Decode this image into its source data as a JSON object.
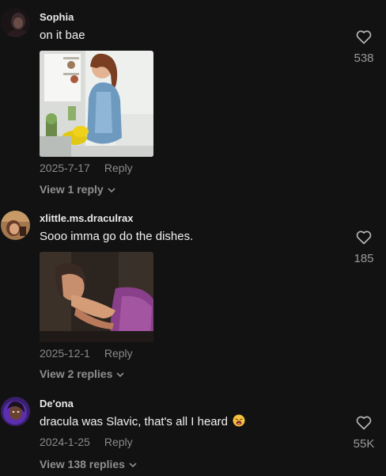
{
  "comments": [
    {
      "username": "Sophia",
      "text": "on it bae",
      "date": "2025-7-17",
      "reply_label": "Reply",
      "view_replies": "View 1 reply",
      "likes": "538"
    },
    {
      "username": "xlittle.ms.draculrax",
      "text": "Sooo imma go do the dishes.",
      "date": "2025-12-1",
      "reply_label": "Reply",
      "view_replies": "View 2 replies",
      "likes": "185"
    },
    {
      "username": "De'ona",
      "text": "dracula was Slavic, that's all I heard",
      "date": "2024-1-25",
      "reply_label": "Reply",
      "view_replies": "View 138 replies",
      "likes": "55K"
    }
  ],
  "icons": {
    "like": "heart-outline-icon",
    "expand": "chevron-down-icon",
    "emoji": "weary-face-emoji"
  },
  "colors": {
    "background": "#121212",
    "secondary_text": "#8a8a8a"
  }
}
